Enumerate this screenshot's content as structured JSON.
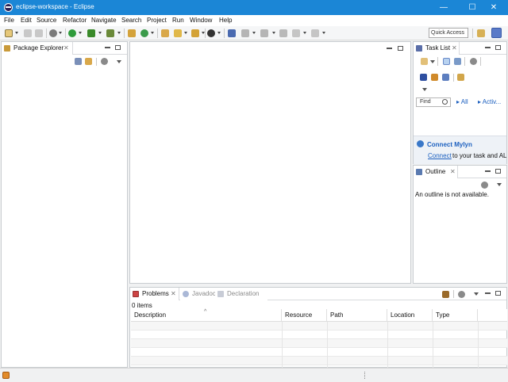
{
  "window": {
    "title": "eclipse-workspace - Eclipse",
    "controls": {
      "minimize": "—",
      "maximize": "☐",
      "close": "✕"
    }
  },
  "menubar": {
    "items": [
      "File",
      "Edit",
      "Source",
      "Refactor",
      "Navigate",
      "Search",
      "Project",
      "Run",
      "Window",
      "Help"
    ]
  },
  "toolbar": {
    "quick_access": "Quick Access"
  },
  "package_explorer": {
    "tab_label": "Package Explorer",
    "close": "✕"
  },
  "task_list": {
    "tab_label": "Task List",
    "close": "✕",
    "find_placeholder": "Find",
    "all_label": "All",
    "activate_label": "Activ...",
    "connect_title": "Connect Mylyn",
    "connect_link": "Connect",
    "connect_text": "to your task and ALM"
  },
  "outline": {
    "tab_label": "Outline",
    "close": "✕",
    "message": "An outline is not available."
  },
  "bottom_panel": {
    "tabs": [
      "Problems",
      "Javadoc",
      "Declaration"
    ],
    "close": "✕",
    "item_count": "0 items",
    "columns": [
      "Description",
      "Resource",
      "Path",
      "Location",
      "Type"
    ]
  },
  "colors": {
    "titlebar": "#1b86d6",
    "link": "#1b5fbf",
    "background": "#f0f1f2"
  }
}
